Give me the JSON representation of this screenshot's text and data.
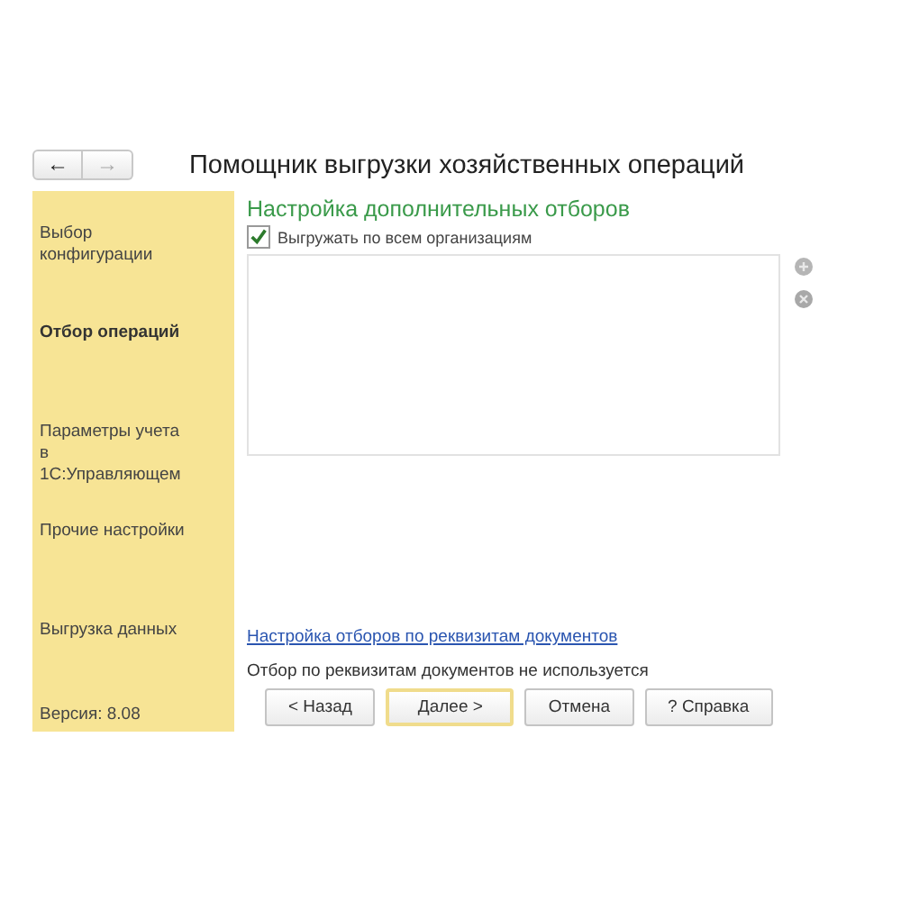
{
  "window": {
    "title": "Помощник выгрузки хозяйственных операций",
    "nav": [
      {
        "label": "←",
        "disabled": false
      },
      {
        "label": "→",
        "disabled": true
      }
    ]
  },
  "sidebar": {
    "items": [
      {
        "label": "Выбор конфигурации",
        "selected": false
      },
      {
        "label": "Отбор операций",
        "selected": true
      },
      {
        "label": "Параметры учета в 1С:Управляющем",
        "selected": false
      },
      {
        "label": "Прочие настройки",
        "selected": false
      },
      {
        "label": "Выгрузка данных",
        "selected": false
      }
    ],
    "version": "Версия: 8.08"
  },
  "content": {
    "heading": "Настройка дополнительных отборов",
    "checkbox": {
      "label": "Выгружать по всем организациям",
      "checked": true
    },
    "link": "Настройка отборов по реквизитам документов",
    "status": "Отбор по реквизитам документов не используется"
  },
  "buttons": [
    {
      "label": "< Назад",
      "default": false
    },
    {
      "label": "Далее >",
      "default": true
    },
    {
      "label": "Отмена",
      "default": false
    },
    {
      "label": "? Справка",
      "default": false
    }
  ]
}
